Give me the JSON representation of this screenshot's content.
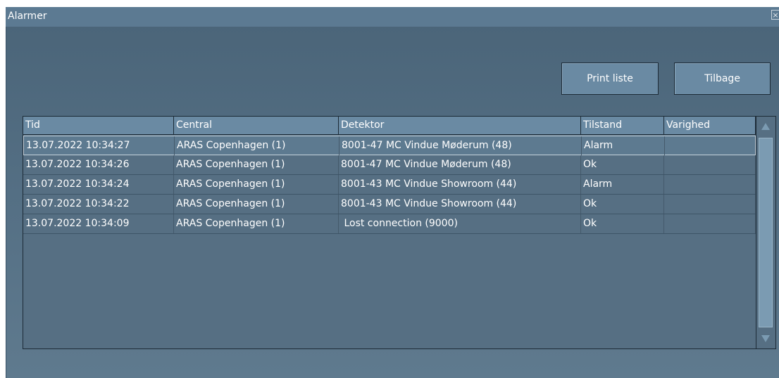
{
  "window": {
    "title": "Alarmer",
    "close_glyph": "×"
  },
  "toolbar": {
    "print_label": "Print liste",
    "back_label": "Tilbage"
  },
  "table": {
    "columns": [
      "Tid",
      "Central",
      "Detektor",
      "Tilstand",
      "Varighed"
    ],
    "rows": [
      [
        "13.07.2022 10:34:27",
        "ARAS Copenhagen (1)",
        "8001-47 MC Vindue Møderum (48)",
        "Alarm",
        ""
      ],
      [
        "13.07.2022 10:34:26",
        "ARAS Copenhagen (1)",
        "8001-47 MC Vindue Møderum (48)",
        "Ok",
        ""
      ],
      [
        "13.07.2022 10:34:24",
        "ARAS Copenhagen (1)",
        "8001-43 MC Vindue Showroom (44)",
        "Alarm",
        ""
      ],
      [
        "13.07.2022 10:34:22",
        "ARAS Copenhagen (1)",
        "8001-43 MC Vindue Showroom (44)",
        "Ok",
        ""
      ],
      [
        "13.07.2022 10:34:09",
        "ARAS Copenhagen (1)",
        " Lost connection (9000)",
        "Ok",
        ""
      ]
    ],
    "selected_row": 0
  },
  "icons": {
    "scroll_up": "scroll-up-arrow-icon",
    "scroll_down": "scroll-down-arrow-icon",
    "close": "close-icon"
  },
  "colors": {
    "background": "#4f687c",
    "titlebar": "#5c7a92",
    "button": "#6a8aa3",
    "header": "#6a8aa3",
    "text": "#ffffff"
  }
}
